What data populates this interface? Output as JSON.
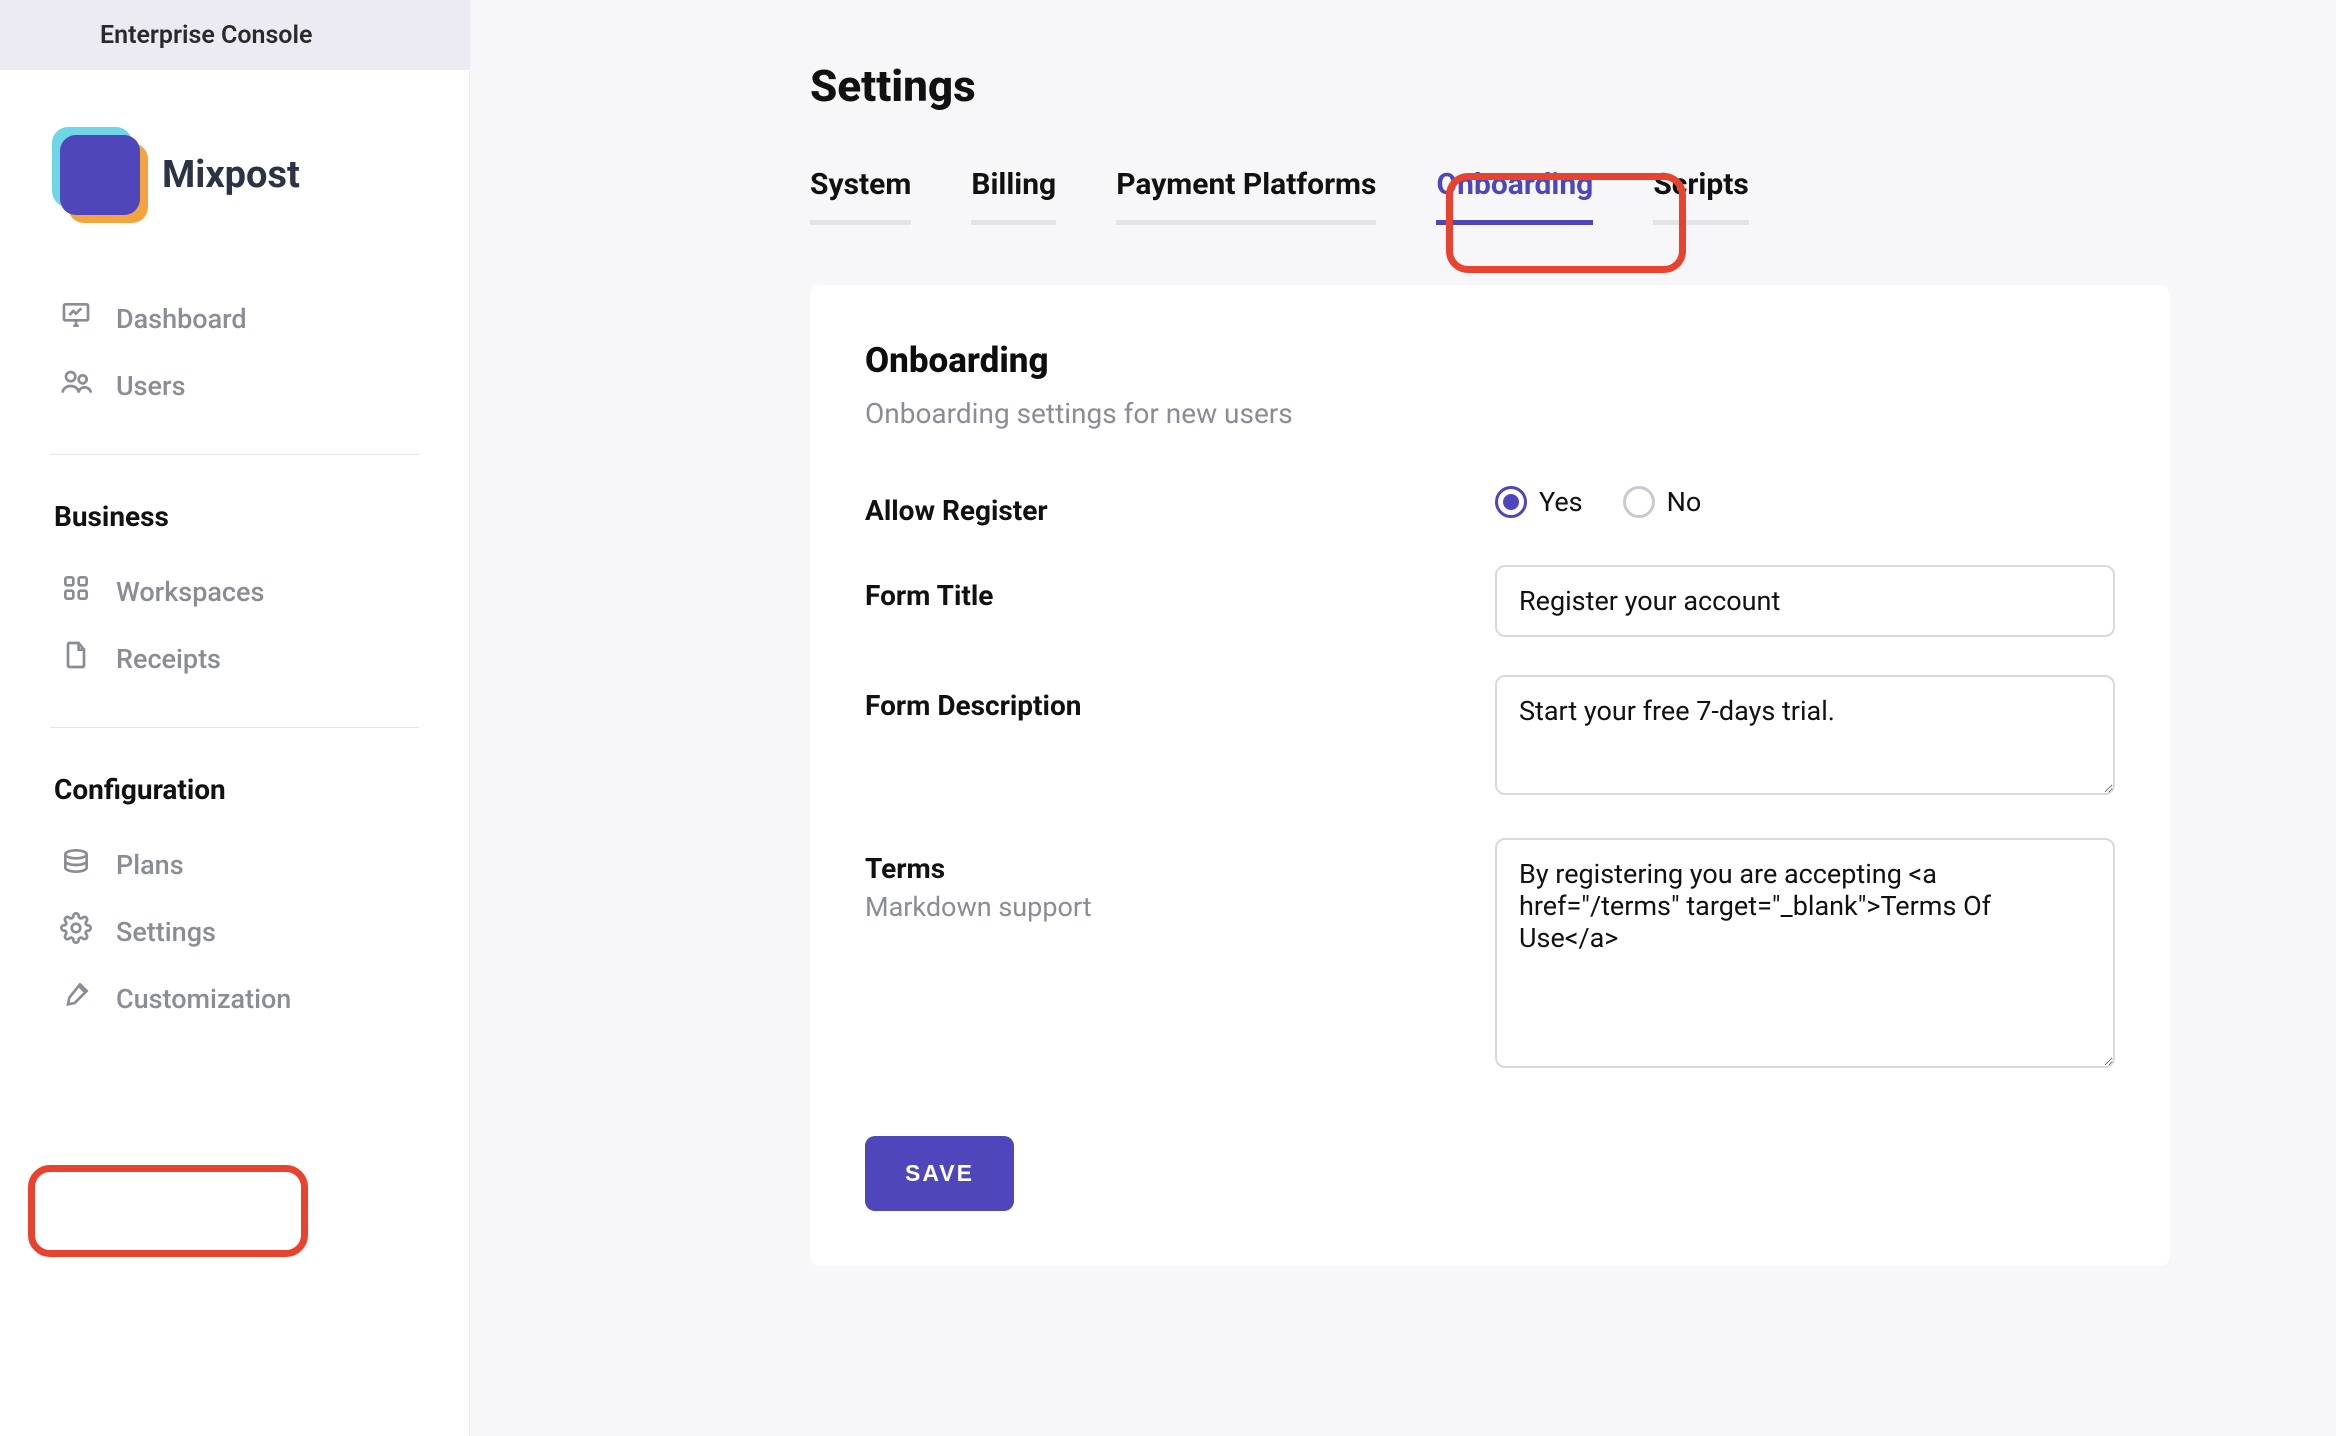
{
  "console_banner": "Enterprise Console",
  "brand": {
    "name": "Mixpost"
  },
  "sidebar": {
    "items_top": [
      {
        "label": "Dashboard"
      },
      {
        "label": "Users"
      }
    ],
    "section_business": "Business",
    "items_business": [
      {
        "label": "Workspaces"
      },
      {
        "label": "Receipts"
      }
    ],
    "section_config": "Configuration",
    "items_config": [
      {
        "label": "Plans"
      },
      {
        "label": "Settings"
      },
      {
        "label": "Customization"
      }
    ]
  },
  "page": {
    "title": "Settings",
    "tabs": [
      {
        "label": "System"
      },
      {
        "label": "Billing"
      },
      {
        "label": "Payment Platforms"
      },
      {
        "label": "Onboarding",
        "active": true
      },
      {
        "label": "Scripts"
      }
    ]
  },
  "card": {
    "title": "Onboarding",
    "subtitle": "Onboarding settings for new users",
    "allow_register_label": "Allow Register",
    "allow_register_options": {
      "yes": "Yes",
      "no": "No"
    },
    "allow_register_value": "yes",
    "form_title_label": "Form Title",
    "form_title_value": "Register your account",
    "form_description_label": "Form Description",
    "form_description_value": "Start your free 7-days trial.",
    "terms_label": "Terms",
    "terms_sublabel": "Markdown support",
    "terms_value": "By registering you are accepting <a href=\"/terms\" target=\"_blank\">Terms Of Use</a>",
    "save_label": "SAVE"
  }
}
